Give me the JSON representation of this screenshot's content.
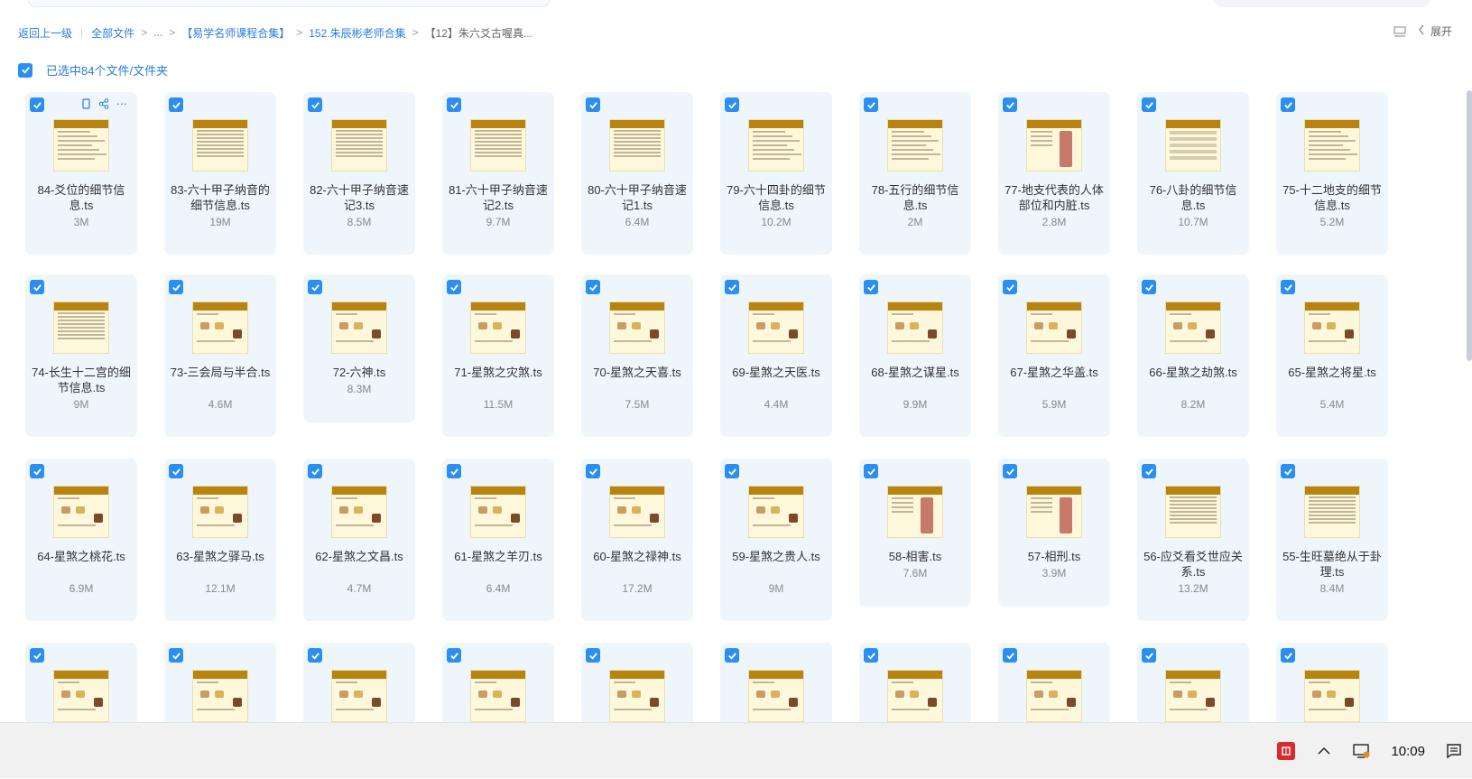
{
  "breadcrumb": {
    "back": "返回上一级",
    "all_files": "全部文件",
    "ellipsis": "...",
    "level1": "【易学名师课程合集】",
    "level2": "152.朱辰彬老师合集",
    "current": "【12】朱六爻古喔真..."
  },
  "view_tools": {
    "expand_label": "展开"
  },
  "selection": {
    "label": "已选中84个文件/文件夹",
    "checked": true
  },
  "files": [
    {
      "name": "84-爻位的细节信息.ts",
      "size": "3M"
    },
    {
      "name": "83-六十甲子纳音的细节信息.ts",
      "size": "19M"
    },
    {
      "name": "82-六十甲子纳音速记3.ts",
      "size": "8.5M"
    },
    {
      "name": "81-六十甲子纳音速记2.ts",
      "size": "9.7M"
    },
    {
      "name": "80-六十甲子纳音速记1.ts",
      "size": "6.4M"
    },
    {
      "name": "79-六十四卦的细节信息.ts",
      "size": "10.2M"
    },
    {
      "name": "78-五行的细节信息.ts",
      "size": "2M"
    },
    {
      "name": "77-地支代表的人体部位和内脏.ts",
      "size": "2.8M"
    },
    {
      "name": "76-八卦的细节信息.ts",
      "size": "10.7M"
    },
    {
      "name": "75-十二地支的细节信息.ts",
      "size": "5.2M"
    },
    {
      "name": "74-长生十二宫的细节信息.ts",
      "size": "9M"
    },
    {
      "name": "73-三会局与半合.ts",
      "size": "4.6M"
    },
    {
      "name": "72-六神.ts",
      "size": "8.3M"
    },
    {
      "name": "71-星煞之灾煞.ts",
      "size": "11.5M"
    },
    {
      "name": "70-星煞之天喜.ts",
      "size": "7.5M"
    },
    {
      "name": "69-星煞之天医.ts",
      "size": "4.4M"
    },
    {
      "name": "68-星煞之谋星.ts",
      "size": "9.9M"
    },
    {
      "name": "67-星煞之华盖.ts",
      "size": "5.9M"
    },
    {
      "name": "66-星煞之劫煞.ts",
      "size": "8.2M"
    },
    {
      "name": "65-星煞之将星.ts",
      "size": "5.4M"
    },
    {
      "name": "64-星煞之桃花.ts",
      "size": "6.9M"
    },
    {
      "name": "63-星煞之驿马.ts",
      "size": "12.1M"
    },
    {
      "name": "62-星煞之文昌.ts",
      "size": "4.7M"
    },
    {
      "name": "61-星煞之羊刃.ts",
      "size": "6.4M"
    },
    {
      "name": "60-星煞之禄神.ts",
      "size": "17.2M"
    },
    {
      "name": "59-星煞之贵人.ts",
      "size": "9M"
    },
    {
      "name": "58-相害.ts",
      "size": "7.6M"
    },
    {
      "name": "57-相刑.ts",
      "size": "3.9M"
    },
    {
      "name": "56-应爻看爻世应关系.ts",
      "size": "13.2M"
    },
    {
      "name": "55-生旺墓绝从于卦理.ts",
      "size": "8.4M"
    }
  ],
  "partial_row_count": 10,
  "taskbar": {
    "time": "10:09"
  },
  "colors": {
    "accent": "#2a8ff0",
    "card_bg": "#eef6fc",
    "thumb_header": "#b8830f"
  }
}
